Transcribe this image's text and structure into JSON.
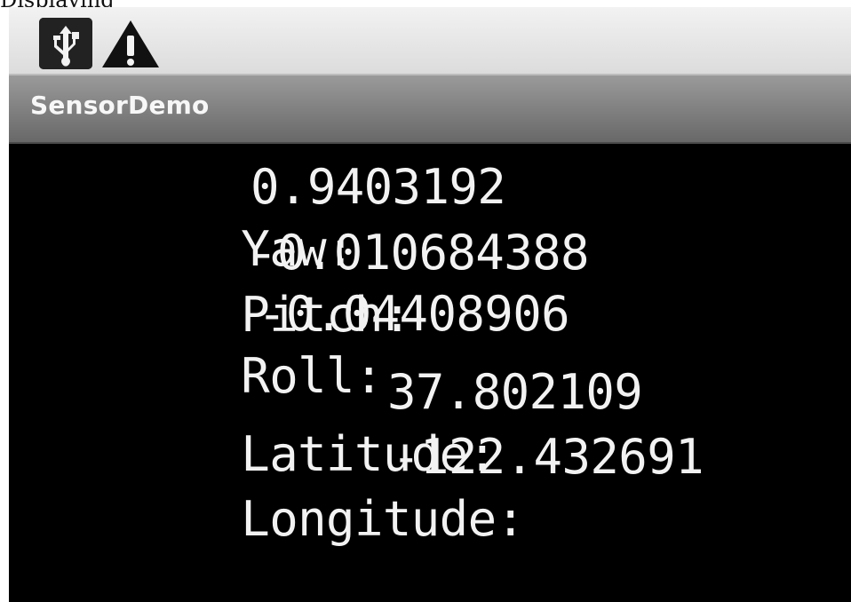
{
  "page_caption_fragment": "Displaying",
  "app": {
    "title": "SensorDemo"
  },
  "status_icons": [
    "usb-icon",
    "warning-icon"
  ],
  "readings": {
    "yaw": {
      "label": "Yaw:",
      "value": "0.9403192"
    },
    "pitch": {
      "label": "Pitch:",
      "value": "-0.010684388"
    },
    "roll": {
      "label": "Roll:",
      "value": "-0.04408906"
    },
    "latitude": {
      "label": "Latitude:",
      "value": "37.802109"
    },
    "longitude": {
      "label": "Longitude:",
      "value": "-122.432691"
    }
  },
  "colors": {
    "screen_background": "#000000",
    "text": "#f2f2f2",
    "title_bar": "#7f7f7f",
    "status_bar": "#e5e5e5"
  }
}
